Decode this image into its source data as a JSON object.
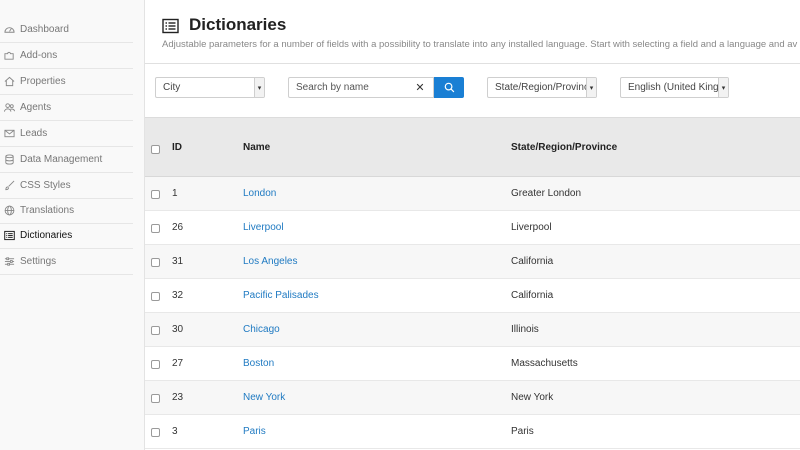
{
  "sidebar": {
    "items": [
      {
        "label": "Dashboard",
        "icon": "dashboard-icon"
      },
      {
        "label": "Add-ons",
        "icon": "puzzle-icon"
      },
      {
        "label": "Properties",
        "icon": "home-icon"
      },
      {
        "label": "Agents",
        "icon": "people-icon"
      },
      {
        "label": "Leads",
        "icon": "envelope-icon"
      },
      {
        "label": "Data Management",
        "icon": "database-icon"
      },
      {
        "label": "CSS Styles",
        "icon": "brush-icon"
      },
      {
        "label": "Translations",
        "icon": "globe-icon"
      },
      {
        "label": "Dictionaries",
        "icon": "list-icon",
        "active": true
      },
      {
        "label": "Settings",
        "icon": "sliders-icon"
      }
    ]
  },
  "header": {
    "title": "Dictionaries",
    "description": "Adjustable parameters for a number of fields with a possibility to translate into any installed language. Start with selecting a field and a language and av"
  },
  "toolbar": {
    "field_select": "City",
    "search_placeholder": "Search by name",
    "clear_label": "✕",
    "column_select": "State/Region/Province",
    "language_select": "English (United Kingdom)"
  },
  "table": {
    "columns": {
      "id": "ID",
      "name": "Name",
      "region": "State/Region/Province"
    },
    "rows": [
      {
        "id": "1",
        "name": "London",
        "region": "Greater London"
      },
      {
        "id": "26",
        "name": "Liverpool",
        "region": "Liverpool"
      },
      {
        "id": "31",
        "name": "Los Angeles",
        "region": "California"
      },
      {
        "id": "32",
        "name": "Pacific Palisades",
        "region": "California"
      },
      {
        "id": "30",
        "name": "Chicago",
        "region": "Illinois"
      },
      {
        "id": "27",
        "name": "Boston",
        "region": "Massachusetts"
      },
      {
        "id": "23",
        "name": "New York",
        "region": "New York"
      },
      {
        "id": "3",
        "name": "Paris",
        "region": "Paris"
      }
    ]
  },
  "colors": {
    "accent": "#1a7fd4",
    "link": "#1f7ac2"
  }
}
